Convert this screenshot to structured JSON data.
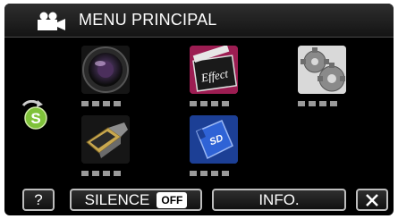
{
  "header": {
    "title": "MENU PRINCIPAL",
    "mode_icon": "video-camera-icon"
  },
  "side": {
    "icon": "silence-mode-s-icon"
  },
  "tiles": [
    {
      "name": "camera-lens-icon"
    },
    {
      "name": "effect-clapper-icon"
    },
    {
      "name": "settings-gears-icon"
    },
    {
      "name": "hdmi-connector-icon"
    },
    {
      "name": "sd-card-icon"
    }
  ],
  "tile_labels": {
    "effect": "Effect",
    "sd": "SD"
  },
  "toolbar": {
    "help_label": "?",
    "silence_label": "SILENCE",
    "silence_state": "OFF",
    "info_label": "INFO.",
    "close_label": "X"
  }
}
